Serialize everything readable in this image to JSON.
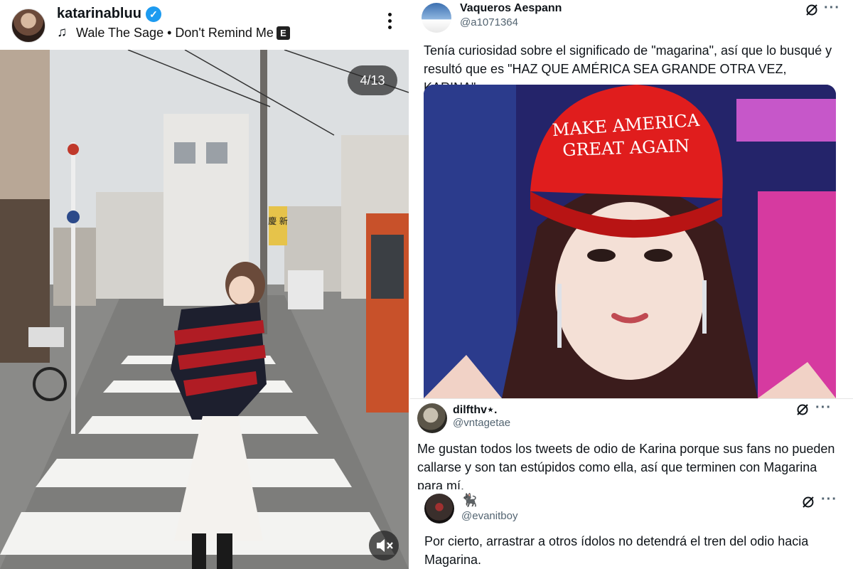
{
  "instagram": {
    "username": "katarinabluu",
    "verified_icon": "verified-badge-icon",
    "music_icon": "♫",
    "track": "Wale The Sage • Don't Remind Me",
    "explicit_badge": "E",
    "slide_counter": "4/13",
    "mute_icon": "speaker-muted-icon",
    "photo_sign_text": "慶 新"
  },
  "tweets": [
    {
      "name": "Vaqueros Aespann",
      "handle": "@a1071364",
      "text": "Tenía curiosidad sobre el significado de \"magarina\", así que lo busqué y resultó que es \"HAZ QUE AMÉRICA SEA GRANDE OTRA VEZ, KARINA\".",
      "media_cap_text_line1": "MAKE AMERICA",
      "media_cap_text_line2": "GREAT AGAIN"
    },
    {
      "name": "dilfthv⋆.",
      "handle": "@vntagetae",
      "text": "Me gustan todos los tweets de odio de Karina porque sus fans no pueden callarse y son tan estúpidos como ella, así que terminen con Magarina para mí."
    },
    {
      "name": "🐈‍⬛",
      "handle": "@evanitboy",
      "text": "Por cierto, arrastrar a otros ídolos no detendrá el tren del odio hacia Magarina."
    }
  ],
  "tweet_actions": {
    "grok_icon": "grok-icon",
    "more_label": "···"
  }
}
